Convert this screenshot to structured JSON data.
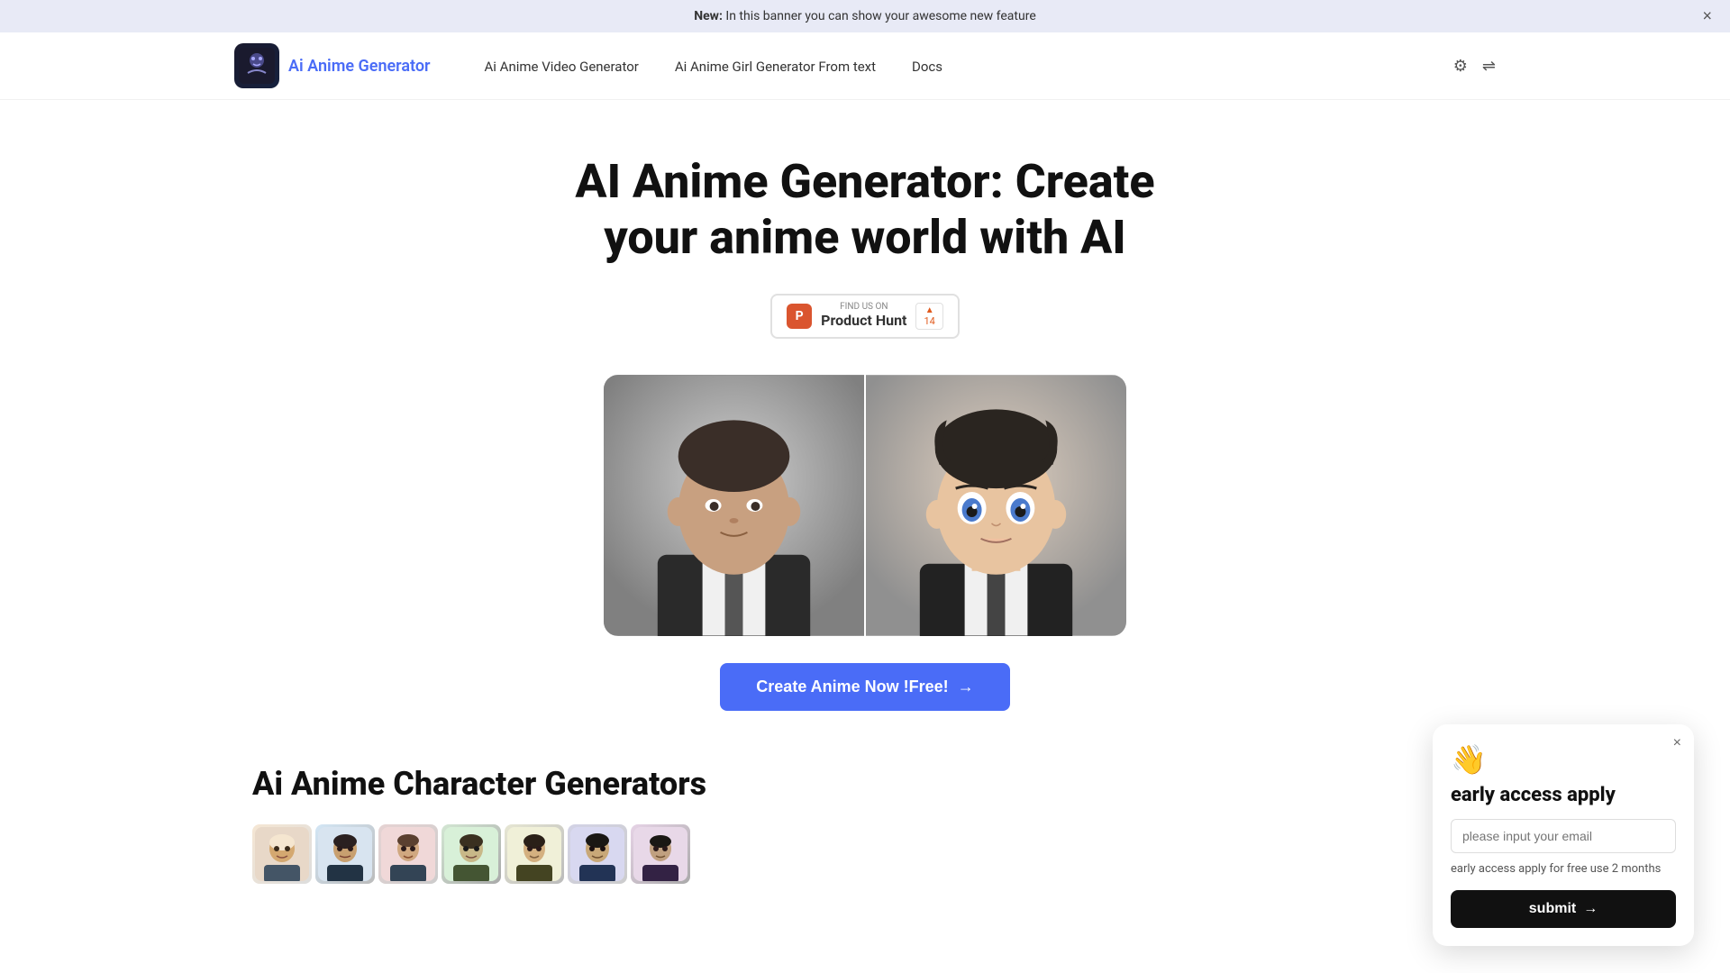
{
  "banner": {
    "new_label": "New:",
    "message": " In this banner you can show your awesome new feature"
  },
  "nav": {
    "logo_text": "Ai Anime Generator",
    "links": [
      {
        "label": "Ai Anime Video Generator",
        "href": "#"
      },
      {
        "label": "Ai Anime Girl Generator From text",
        "href": "#"
      },
      {
        "label": "Docs",
        "href": "#"
      }
    ]
  },
  "hero": {
    "title": "AI Anime Generator: Create your anime world with AI",
    "product_hunt": {
      "find_text": "FIND US ON",
      "name": "Product Hunt",
      "count": "14"
    },
    "cta_label": "Create Anime Now !Free!",
    "cta_arrow": "→"
  },
  "characters_section": {
    "title": "Ai Anime Character Generators",
    "faces": [
      "👤",
      "👤",
      "👤",
      "👤",
      "👤",
      "👤",
      "👤"
    ]
  },
  "popup": {
    "wave": "👋",
    "title": "early access apply",
    "email_placeholder": "please input your email",
    "description": "early access apply for free use 2 months",
    "submit_label": "submit",
    "submit_arrow": "→"
  },
  "icons": {
    "settings": "⚙",
    "translate": "⇌",
    "close": "×",
    "arrow_up": "▲"
  }
}
